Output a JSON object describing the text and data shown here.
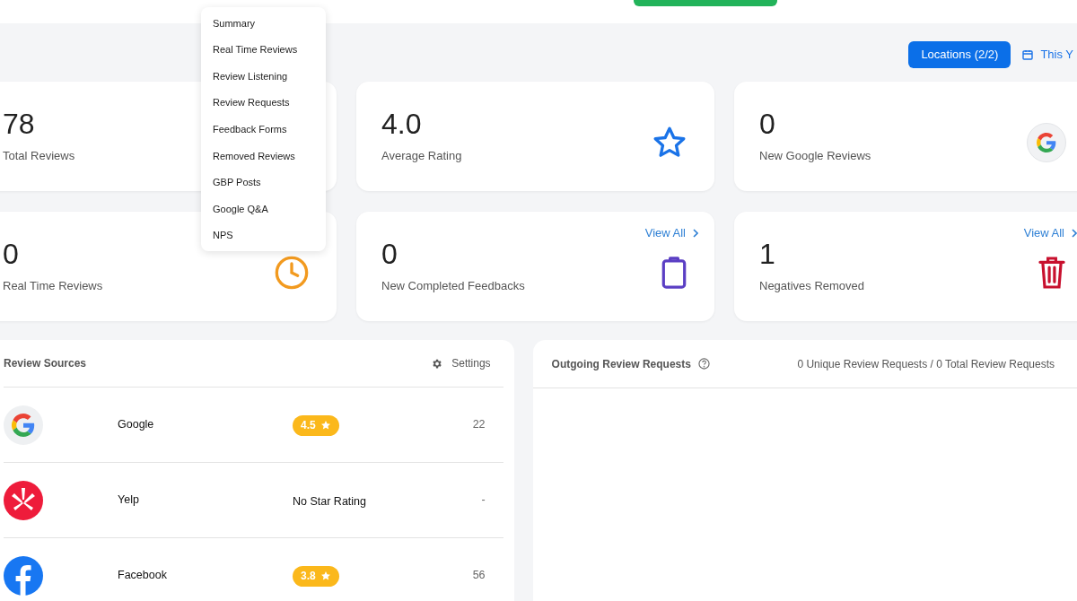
{
  "toolbar": {
    "locations_button": "Locations (2/2)",
    "date_range": "This Y"
  },
  "menu": {
    "items": [
      {
        "label": "Summary"
      },
      {
        "label": "Real Time Reviews"
      },
      {
        "label": "Review Listening"
      },
      {
        "label": "Review Requests"
      },
      {
        "label": "Feedback Forms"
      },
      {
        "label": "Removed Reviews"
      },
      {
        "label": "GBP Posts"
      },
      {
        "label": "Google Q&A"
      },
      {
        "label": "NPS"
      }
    ]
  },
  "stat_cards": [
    {
      "value": "78",
      "label": "Total Reviews",
      "kind": "plain"
    },
    {
      "value": "4.0",
      "label": "Average Rating",
      "kind": "star"
    },
    {
      "value": "0",
      "label": "New Google Reviews",
      "kind": "google"
    },
    {
      "value": "0",
      "label": "Real Time Reviews",
      "kind": "clock"
    },
    {
      "value": "0",
      "label": "New Completed Feedbacks",
      "kind": "clipboard",
      "link": "View All"
    },
    {
      "value": "1",
      "label": "Negatives Removed",
      "kind": "trash",
      "link": "View All"
    }
  ],
  "review_sources": {
    "title": "Review Sources",
    "settings": "Settings",
    "rows": [
      {
        "kind": "google",
        "name": "Google",
        "rating": "4.5",
        "count": "22"
      },
      {
        "kind": "yelp",
        "name": "Yelp",
        "rating_text": "No Star Rating",
        "count": "-"
      },
      {
        "kind": "facebook",
        "name": "Facebook",
        "rating": "3.8",
        "count": "56"
      }
    ]
  },
  "outgoing": {
    "title": "Outgoing Review Requests",
    "summary": "0 Unique Review Requests / 0 Total Review Requests"
  }
}
